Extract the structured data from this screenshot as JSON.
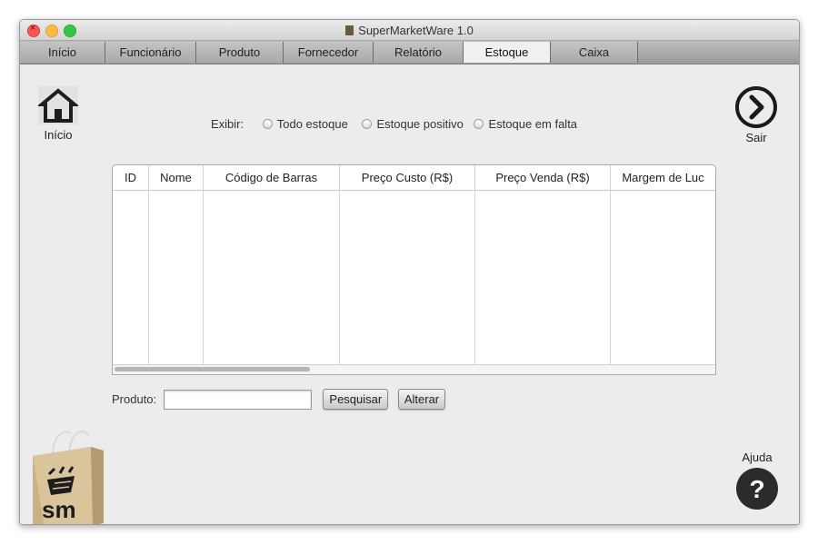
{
  "window": {
    "title": "SuperMarketWare 1.0"
  },
  "tabs": [
    {
      "label": "Início",
      "active": false
    },
    {
      "label": "Funcionário",
      "active": false
    },
    {
      "label": "Produto",
      "active": false
    },
    {
      "label": "Fornecedor",
      "active": false
    },
    {
      "label": "Relatório",
      "active": false
    },
    {
      "label": "Estoque",
      "active": true
    },
    {
      "label": "Caixa",
      "active": false
    }
  ],
  "nav": {
    "home_label": "Início",
    "home_icon": "home-icon",
    "exit_label": "Sair",
    "exit_icon": "chevron-right-circle-icon",
    "help_label": "Ajuda",
    "help_icon": "question-mark-icon"
  },
  "filter": {
    "label": "Exibir:",
    "options": [
      "Todo estoque",
      "Estoque positivo",
      "Estoque em falta"
    ]
  },
  "table": {
    "columns": [
      "ID",
      "Nome",
      "Código de Barras",
      "Preço Custo (R$)",
      "Preço Venda (R$)",
      "Margem de Luc"
    ],
    "rows": []
  },
  "search": {
    "label": "Produto:",
    "value": "",
    "search_button": "Pesquisar",
    "edit_button": "Alterar"
  },
  "logo": {
    "text": "sm",
    "icon": "shopping-bag-logo"
  },
  "colors": {
    "help_circle": "#2b2b2b",
    "tab_active": "#f0f0f0",
    "bag": "#d8c29a"
  }
}
